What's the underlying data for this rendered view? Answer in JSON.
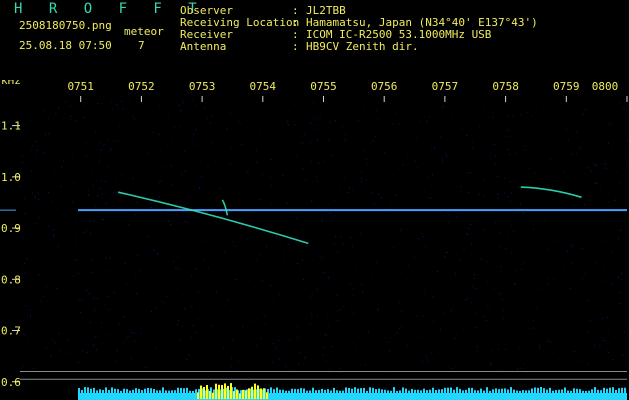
{
  "app": {
    "title": "H R O F F T",
    "filename": "2508180750.png",
    "datetime": "25.08.18 07:50",
    "meteor_label": "meteor",
    "meteor_count": "7"
  },
  "station": [
    {
      "label": "Observer",
      "value": "JL2TBB"
    },
    {
      "label": "Receiving Location",
      "value": "Hamamatsu, Japan (N34°40' E137°43')"
    },
    {
      "label": "Receiver",
      "value": "ICOM IC-R2500 53.1000MHz USB"
    },
    {
      "label": "Antenna",
      "value": "HB9CV Zenith dir."
    }
  ],
  "colors": {
    "text": "#f0ec60",
    "title": "#38d8b0",
    "grid": "#d8d8d8",
    "carrier": "#4aa0ff",
    "meteor": "#30e0c0",
    "level": "#20d8ff",
    "level_peak": "#ffff20"
  },
  "chart_data": {
    "type": "spectrogram",
    "ylabel": "kHz",
    "x_ticks": [
      "0751",
      "0752",
      "0753",
      "0754",
      "0755",
      "0756",
      "0757",
      "0758",
      "0759",
      "0800"
    ],
    "y_ticks": [
      "1.1",
      "1.0",
      "0.9",
      "0.8",
      "0.7",
      "0.6"
    ],
    "xlim": [
      "07:50",
      "08:00"
    ],
    "ylim": [
      0.58,
      1.15
    ],
    "carrier_khz": 0.935,
    "echoes": [
      {
        "start": "07:51:37",
        "end": "07:54:45",
        "start_khz": 0.97,
        "end_khz": 0.87
      },
      {
        "start": "07:53:20",
        "end": "07:53:25",
        "start_khz": 0.955,
        "end_khz": 0.925
      },
      {
        "start": "07:58:15",
        "end": "07:59:15",
        "start_khz": 0.98,
        "end_khz": 0.96
      }
    ],
    "baselines_khz": [
      0.62,
      0.605
    ]
  }
}
